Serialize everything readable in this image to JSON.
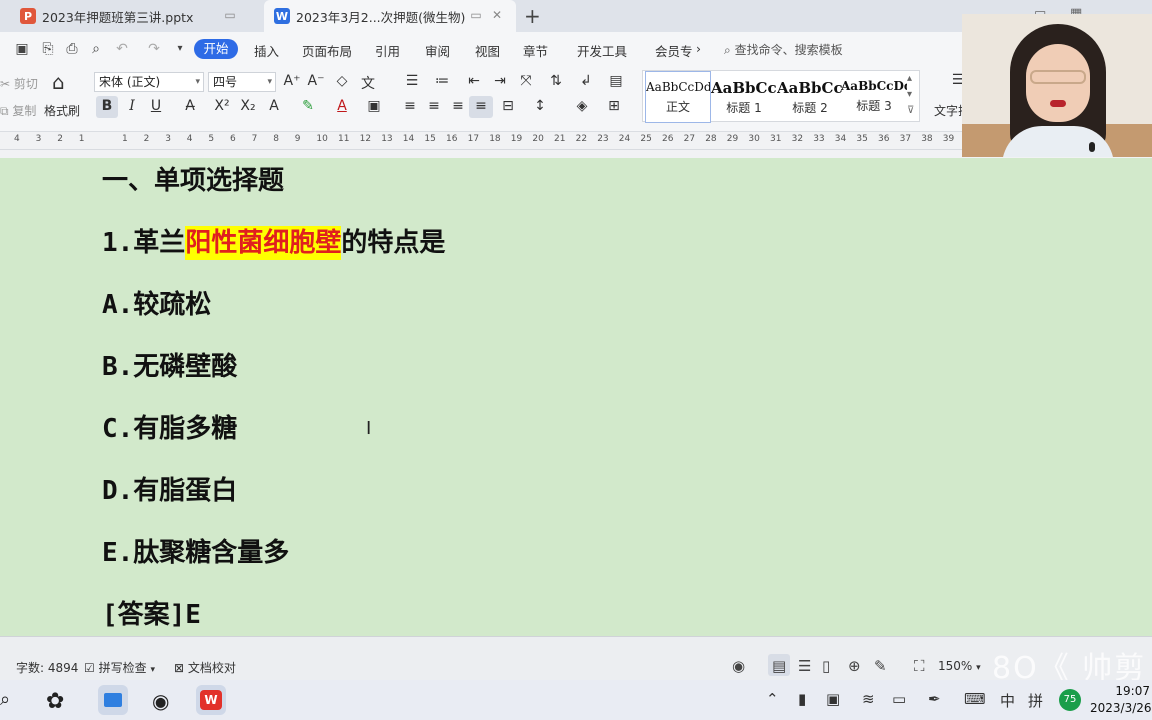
{
  "tabs": [
    {
      "label": "2023年押题班第三讲.pptx",
      "icon": "P"
    },
    {
      "label": "2023年3月2...次押题(微生物)",
      "icon": "W"
    }
  ],
  "menu": {
    "start": "开始",
    "items": [
      "插入",
      "页面布局",
      "引用",
      "审阅",
      "视图",
      "章节",
      "开发工具",
      "会员专"
    ],
    "more": "›",
    "search_placeholder": "查找命令、搜索模板"
  },
  "toolbar": {
    "cut": "剪切",
    "copy": "复制",
    "format_painter": "格式刷",
    "font_name": "宋体 (正文)",
    "font_size": "四号",
    "styles": [
      {
        "sample": "AaBbCcDd",
        "name": "正文"
      },
      {
        "sample": "AaBbCcI",
        "name": "标题 1"
      },
      {
        "sample": "AaBbCcI",
        "name": "标题 2"
      },
      {
        "sample": "AaBbCcDd",
        "name": "标题 3"
      }
    ],
    "text_tool": "文字排"
  },
  "ruler": {
    "numbers": [
      "4",
      "3",
      "2",
      "1",
      "",
      "1",
      "2",
      "3",
      "4",
      "5",
      "6",
      "7",
      "8",
      "9",
      "10",
      "11",
      "12",
      "13",
      "14",
      "15",
      "16",
      "17",
      "18",
      "19",
      "20",
      "21",
      "22",
      "23",
      "24",
      "25",
      "26",
      "27",
      "28",
      "29",
      "30",
      "31",
      "32",
      "33",
      "34",
      "35",
      "36",
      "37",
      "38",
      "39",
      "40",
      "4"
    ]
  },
  "document": {
    "heading": "一、单项选择题",
    "question_prefix": "1.革兰",
    "question_highlight": "阳性菌细胞壁",
    "question_suffix": "的特点是",
    "options": [
      "A.较疏松",
      "B.无磷壁酸",
      "C.有脂多糖",
      "D.有脂蛋白",
      "E.肽聚糖含量多"
    ],
    "answer": "[答案]E"
  },
  "status": {
    "word_count": "字数: 4894",
    "spell_check": "拼写检查",
    "doc_proof": "文档校对",
    "zoom": "150%",
    "watermark": "8O《 帅剪辑"
  },
  "taskbar": {
    "ime_lang": "中",
    "ime_mode": "拼",
    "badge": "75",
    "time": "19:07",
    "date": "2023/3/26"
  }
}
